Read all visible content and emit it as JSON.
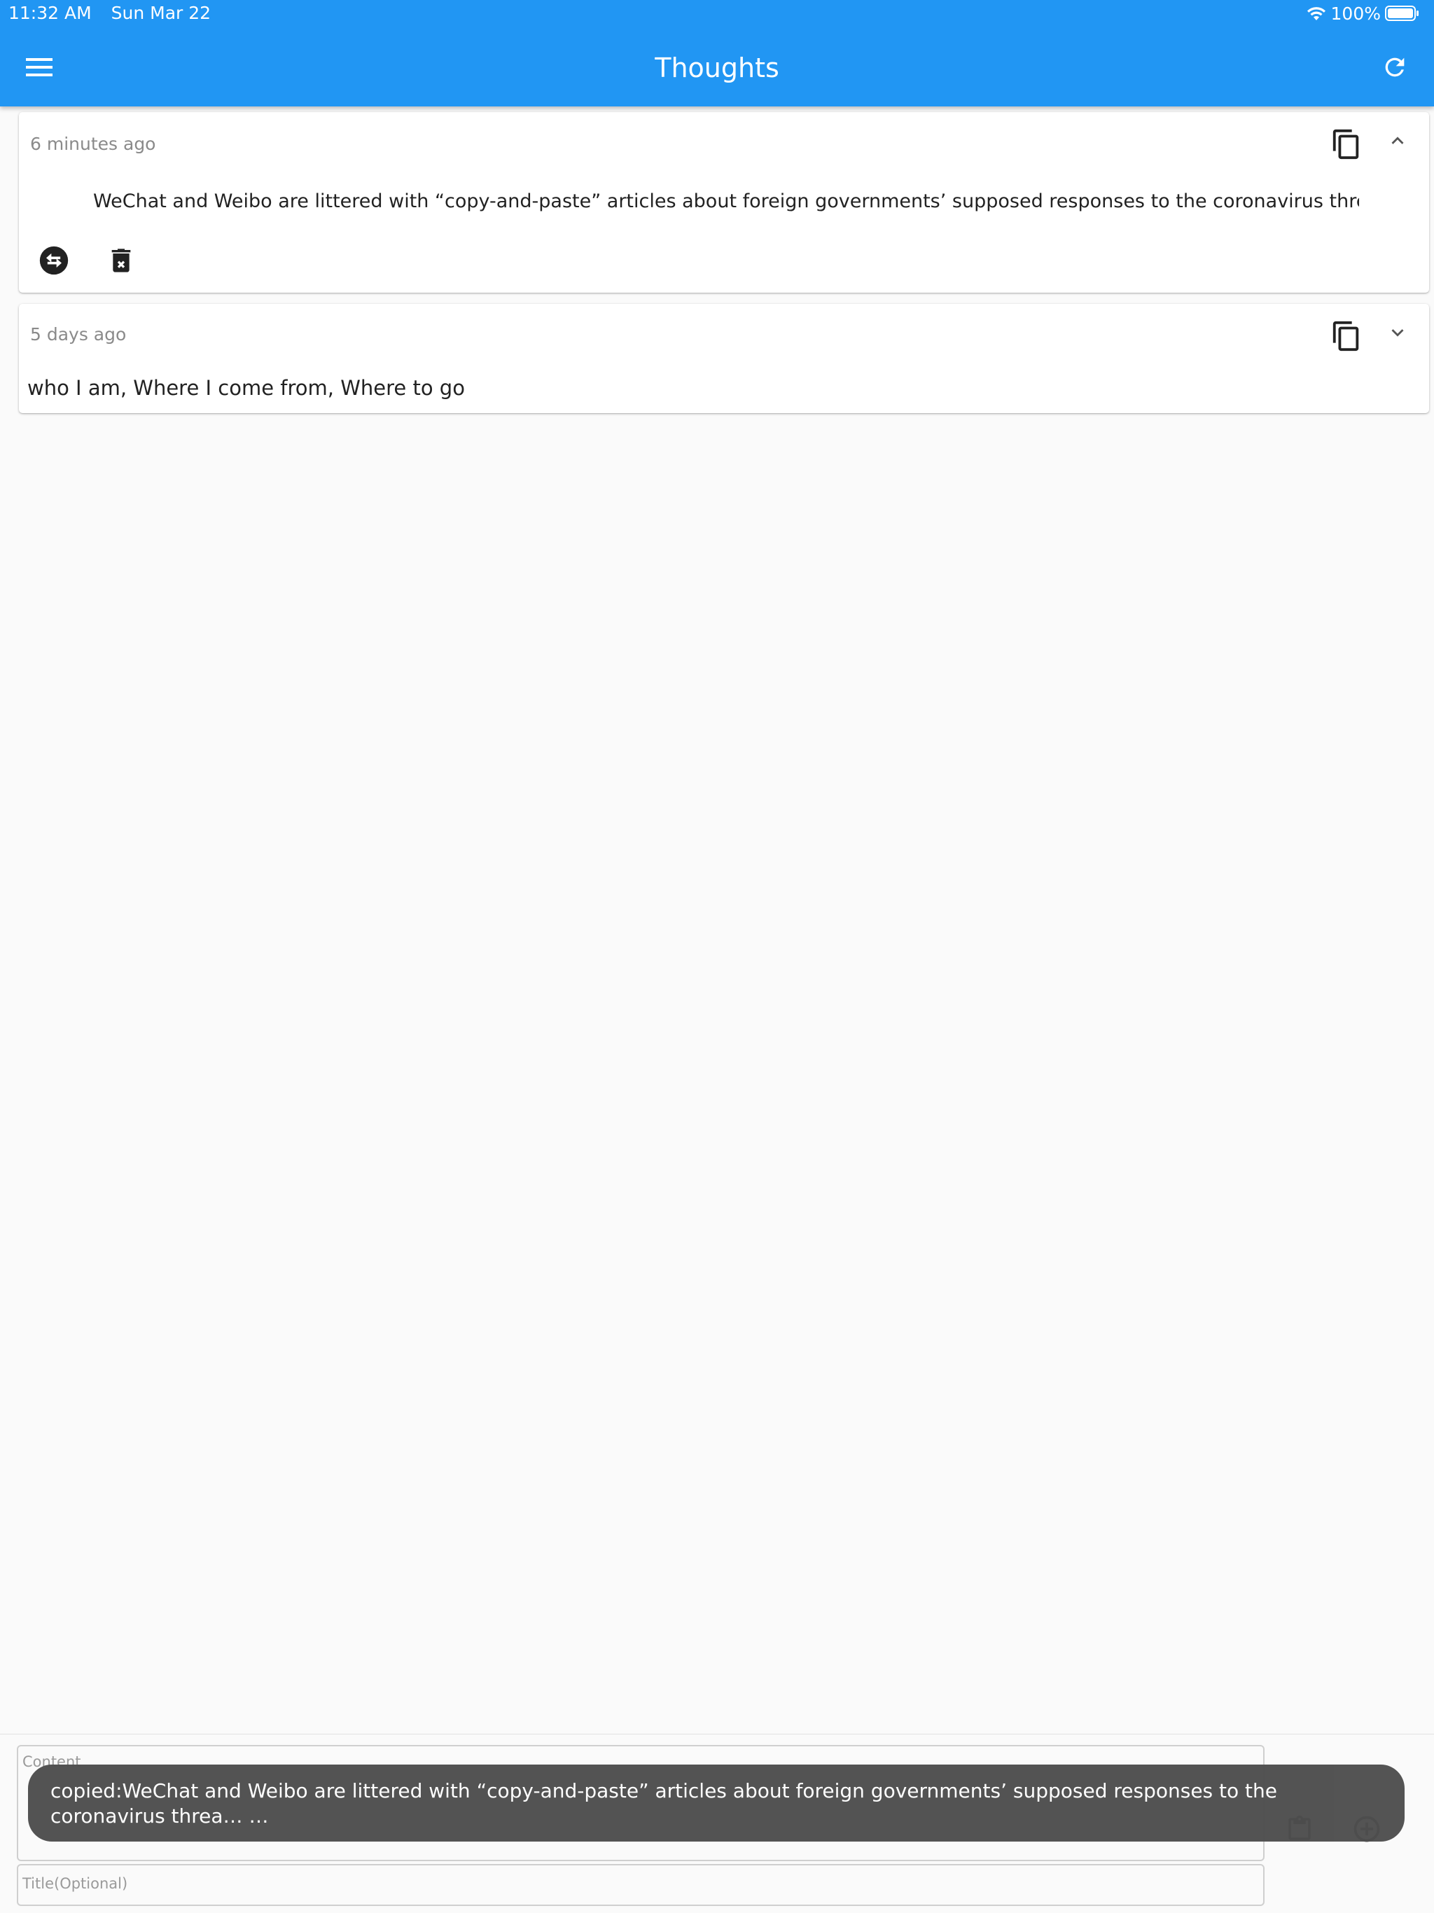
{
  "status_bar": {
    "time": "11:32 AM",
    "date": "Sun Mar 22",
    "battery": "100%",
    "wifi_icon": "wifi-icon",
    "battery_icon": "battery-icon"
  },
  "app_bar": {
    "title": "Thoughts",
    "menu_icon": "hamburger-menu-icon",
    "refresh_icon": "refresh-icon",
    "color": "#2196f3"
  },
  "thoughts": [
    {
      "timestamp": "6 minutes ago",
      "content": "WeChat and Weibo are littered with “copy-and-paste” articles about foreign governments’ supposed responses to the coronavirus threa… …",
      "expanded": true,
      "copy_icon": "copy-icon",
      "toggle_icon": "chevron-up-icon",
      "actions": [
        "swap-icon",
        "delete-icon"
      ]
    },
    {
      "timestamp": "5 days ago",
      "content": "who I am, Where I come from, Where to go",
      "expanded": false,
      "copy_icon": "copy-icon",
      "toggle_icon": "chevron-down-icon"
    }
  ],
  "composer": {
    "content_label": "Content",
    "title_label": "Title(Optional)",
    "paste_icon": "clipboard-icon",
    "add_icon": "add-circle-icon"
  },
  "snackbar": {
    "message": "copied:WeChat and Weibo are littered with “copy-and-paste” articles about foreign governments’ supposed responses to the coronavirus threa… …"
  }
}
